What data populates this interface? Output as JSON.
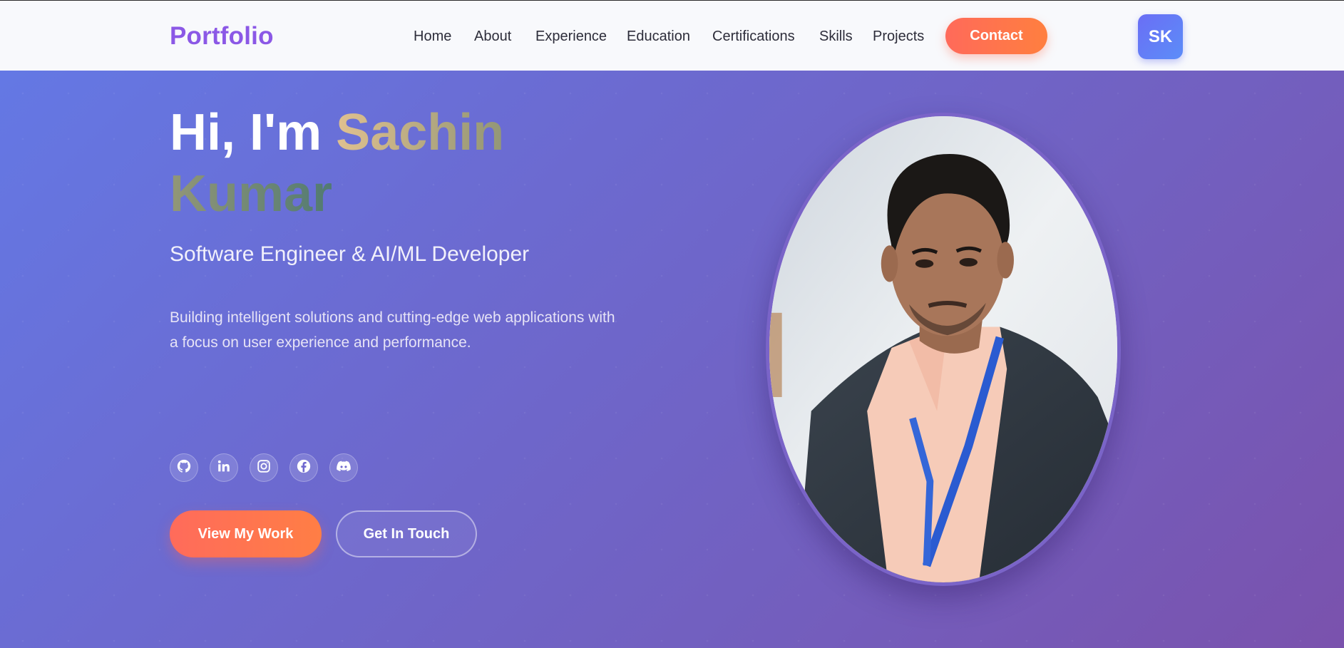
{
  "nav": {
    "logo": "Portfolio",
    "links": [
      "Home",
      "About",
      "Experience",
      "Education",
      "Certifications",
      "Skills",
      "Projects"
    ],
    "contact_label": "Contact",
    "avatar_initials": "SK"
  },
  "hero": {
    "greeting": "Hi, I'm",
    "name": "Sachin Kumar",
    "subtitle": "Software Engineer & AI/ML Developer",
    "description": "Building intelligent solutions and cutting-edge web applications with a focus on user experience and performance.",
    "socials": [
      "github-icon",
      "linkedin-icon",
      "instagram-icon",
      "facebook-icon",
      "discord-icon"
    ],
    "primary_button": "View My Work",
    "secondary_button": "Get In Touch"
  },
  "colors": {
    "brand": "#8b58e6",
    "accent": "#ff6b5b",
    "hero_start": "#6478e4",
    "hero_end": "#7a52ad"
  }
}
